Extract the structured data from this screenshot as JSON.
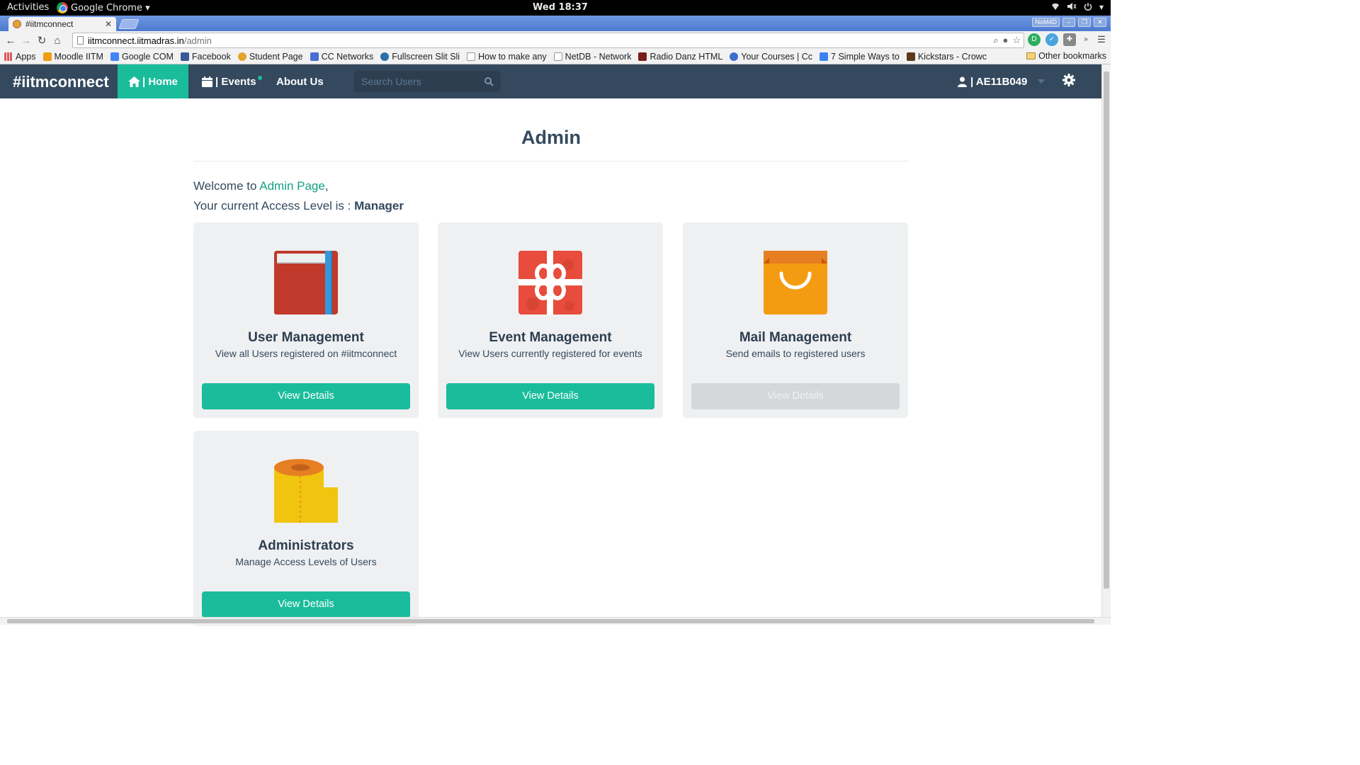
{
  "os_bar": {
    "activities": "Activities",
    "app_name": "Google Chrome ▾",
    "clock": "Wed 18:37"
  },
  "browser": {
    "tab_title": "#iitmconnect",
    "url_host": "iitmconnect.iitmadras.in",
    "url_path": "/admin",
    "profile_badge": "NoM4D",
    "bookmarks": [
      "Apps",
      "Moodle IITM",
      "Google COM",
      "Facebook",
      "Student Page",
      "CC Networks",
      "Fullscreen Slit Sli",
      "How to make any",
      "NetDB - Network",
      "Radio Danz HTML",
      "Your Courses | Cc",
      "7 Simple Ways to",
      "Kickstars - Crowc"
    ],
    "other_bookmarks": "Other bookmarks"
  },
  "navbar": {
    "brand": "#iitmconnect",
    "home": "| Home",
    "events": "| Events",
    "about": "About Us",
    "search_placeholder": "Search Users",
    "user": "| AE11B049"
  },
  "page": {
    "title": "Admin",
    "welcome_prefix": "Welcome to ",
    "welcome_link": "Admin Page",
    "welcome_suffix": ",",
    "access_prefix": "Your current Access Level is : ",
    "access_level": "Manager"
  },
  "cards": [
    {
      "title": "User Management",
      "description": "View all Users registered on #iitmconnect",
      "button": "View Details",
      "enabled": true,
      "icon": "book-icon"
    },
    {
      "title": "Event Management",
      "description": "View Users currently registered for events",
      "button": "View Details",
      "enabled": true,
      "icon": "gift-icon"
    },
    {
      "title": "Mail Management",
      "description": "Send emails to registered users",
      "button": "View Details",
      "enabled": false,
      "icon": "shopping-bag-icon"
    },
    {
      "title": "Administrators",
      "description": "Manage Access Levels of Users",
      "button": "View Details",
      "enabled": true,
      "icon": "paper-roll-icon"
    }
  ],
  "colors": {
    "navbar": "#34495e",
    "accent": "#1abc9c",
    "card_bg": "#eff0f2",
    "disabled": "#d5d8db"
  }
}
